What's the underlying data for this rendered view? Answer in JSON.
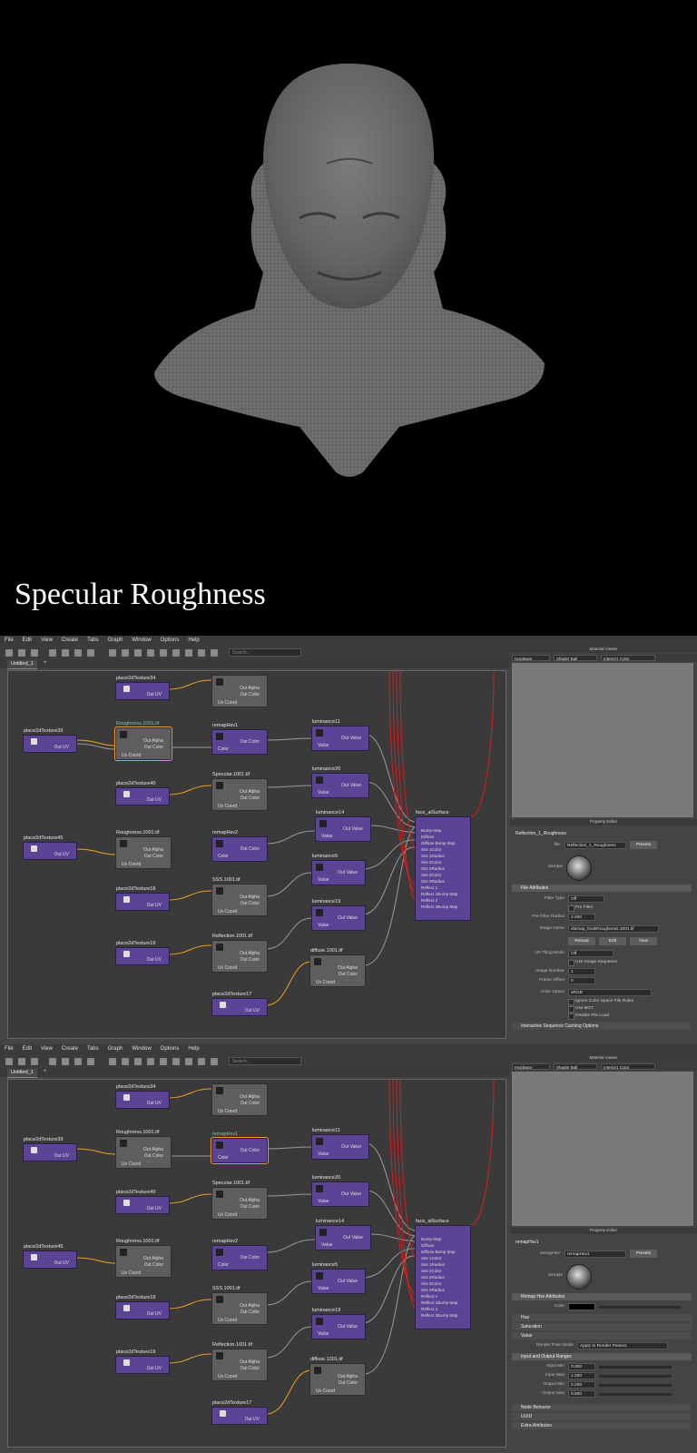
{
  "caption": "Specular Roughness",
  "menu": [
    "File",
    "Edit",
    "View",
    "Create",
    "Tabs",
    "Graph",
    "Window",
    "Options",
    "Help"
  ],
  "search_placeholder": "Search...",
  "tab_label": "Untitled_1",
  "tab_plus": "+",
  "nodes": {
    "place2dTexture34": "place2dTexture34",
    "place2dTexture39": "place2dTexture39",
    "place2dTexture40": "place2dTexture40",
    "place2dTexture45": "place2dTexture45",
    "place2dTexture18": "place2dTexture18",
    "place2dTexture19": "place2dTexture19",
    "place2dTexture17": "place2dTexture17",
    "roughness_a": "Roughness.1001.tif",
    "specular": "Specular.1001.tif",
    "roughness_b": "Roughness.1001.tif",
    "sss": "SSS.1001.tif",
    "reflection": "Reflection.1001.tif",
    "diffuse": "diffuse.1001.tif",
    "remapHsv1": "remapHsv1",
    "remapHsv2": "remapHsv2",
    "luminance11": "luminance11",
    "luminance20": "luminance20",
    "luminance14": "luminance14",
    "luminance5": "luminance5",
    "luminance19": "luminance19",
    "surface": "face_aiSurface"
  },
  "ports": {
    "out_uv": "Out UV",
    "out_alpha": "Out Alpha",
    "out_color": "Out Color",
    "uv_coord": "Uv Coord",
    "color": "Color",
    "out_value": "Out Value",
    "value": "Value"
  },
  "surface_inputs": [
    "Bump Map",
    "Diffuse",
    "Diffuse Bump Map",
    "Sss 1Color",
    "Sss 1Radius",
    "Sss 2Color",
    "Sss 2Radius",
    "Sss 3Color",
    "Sss 3Radius",
    "Reflect 1",
    "Reflect 1Bump Map",
    "Reflect 2",
    "Reflect 2Bump Map"
  ],
  "material_viewer": {
    "title": "Material Viewer",
    "renderer": "Hardware",
    "shape": "Shader Ball",
    "env": "Interior1 Color"
  },
  "property_editor_title": "Property Editor",
  "pe1": {
    "node_title": "Reflection_1_Roughness",
    "file_label": "file:",
    "file_value": "Reflection_1_Roughness",
    "presets": "Presets",
    "sample": "Sample",
    "section": "File Attributes",
    "filter_type_label": "Filter Type",
    "filter_type": "Off",
    "pre_filter": "Pre Filter",
    "pre_filter_radius_label": "Pre Filter Radius",
    "pre_filter_radius": "2.000",
    "image_name_label": "Image Name",
    "image_name": "dismap_final\\Roughness.1001.tif",
    "reload": "Reload",
    "edit": "Edit",
    "view": "View",
    "uv_tiling_label": "UV Tiling Mode",
    "uv_tiling": "Off",
    "use_image_seq": "Use Image Sequence",
    "image_number_label": "Image Number",
    "image_number": "1",
    "frame_offset_label": "Frame Offset",
    "frame_offset": "0",
    "color_space_label": "Color Space",
    "color_space": "sRGB",
    "ignore_cs": "Ignore Color Space File Rules",
    "use_bot": "Use BOT",
    "disable_file_load": "Disable File Load",
    "section2": "Interactive Sequence Caching Options"
  },
  "pe2": {
    "node_title": "remapHsv1",
    "file_label": "remapHsv:",
    "file_value": "remapHsv1",
    "presets": "Presets",
    "sample": "Sample",
    "section": "Remap Hsv Attributes",
    "color_label": "Color",
    "hue": "Hue",
    "saturation": "Saturation",
    "value": "Value",
    "render_pass_label": "Render Pass Mode",
    "render_pass": "Apply to Render Passes",
    "section_io": "Input and Output Ranges",
    "input_min_label": "Input Min",
    "input_min": "0.000",
    "input_max_label": "Input Max",
    "input_max": "1.000",
    "output_min_label": "Output Min",
    "output_min": "0.000",
    "output_max_label": "Output Max",
    "output_max": "0.800",
    "node_behavior": "Node Behavior",
    "uuid": "UUID",
    "extra": "Extra Attributes"
  }
}
